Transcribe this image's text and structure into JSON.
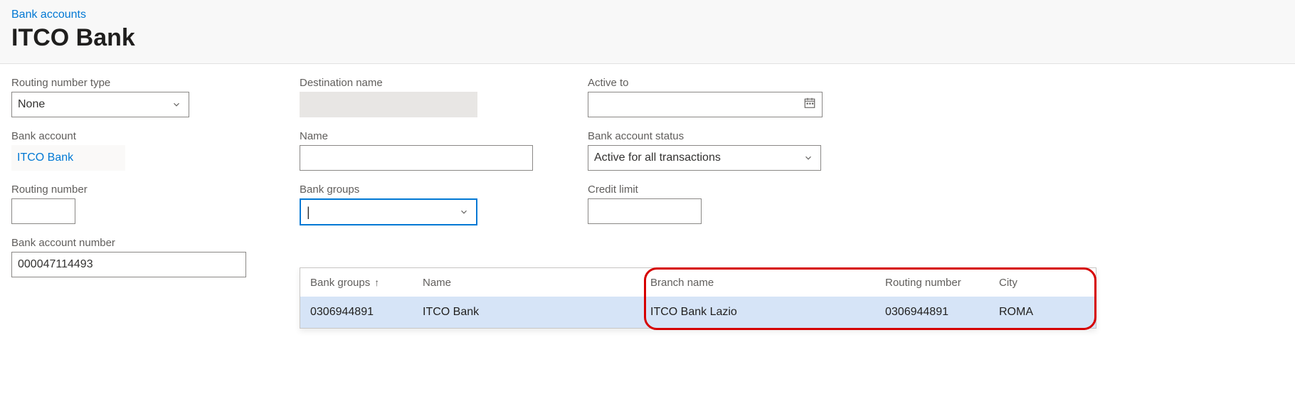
{
  "breadcrumb": "Bank accounts",
  "title": "ITCO Bank",
  "col1": {
    "routing_type_label": "Routing number type",
    "routing_type_value": "None",
    "bank_account_label": "Bank account",
    "bank_account_value": "ITCO Bank",
    "routing_number_label": "Routing number",
    "routing_number_value": "",
    "bank_account_number_label": "Bank account number",
    "bank_account_number_value": "000047114493"
  },
  "col2": {
    "destination_name_label": "Destination name",
    "name_label": "Name",
    "name_value": "",
    "bank_groups_label": "Bank groups",
    "bank_groups_value": ""
  },
  "col3": {
    "active_to_label": "Active to",
    "active_to_value": "",
    "status_label": "Bank account status",
    "status_value": "Active for all transactions",
    "credit_limit_label": "Credit limit",
    "credit_limit_value": ""
  },
  "dropdown": {
    "headers": {
      "bank_groups": "Bank groups",
      "name": "Name",
      "branch_name": "Branch name",
      "routing_number": "Routing number",
      "city": "City"
    },
    "row": {
      "bank_groups": "0306944891",
      "name": "ITCO Bank",
      "branch_name": "ITCO Bank Lazio",
      "routing_number": "0306944891",
      "city": "ROMA"
    }
  }
}
